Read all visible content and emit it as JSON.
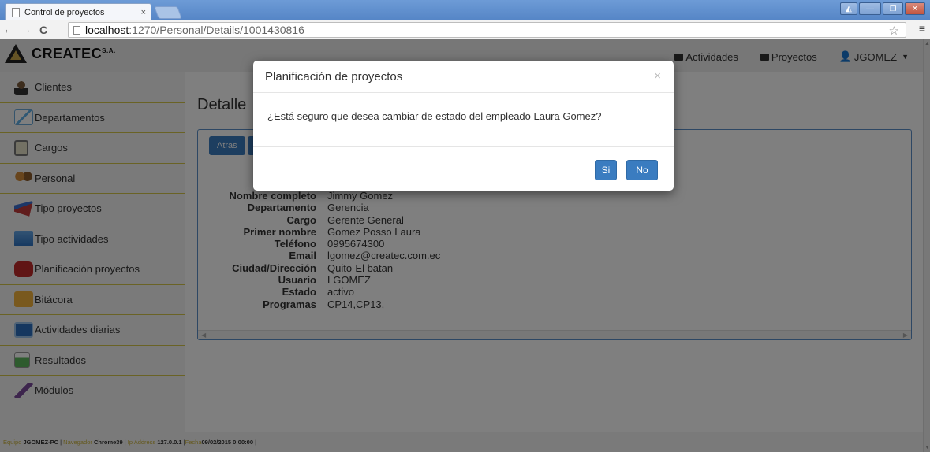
{
  "browser": {
    "tab_title": "Control de proyectos",
    "tab_close": "×",
    "url_host": "localhost",
    "url_path": ":1270/Personal/Details/1001430816",
    "win_controls": [
      "◭",
      "—",
      "❐",
      "✕"
    ]
  },
  "navbar": {
    "brand": "CREATEC",
    "brand_suffix": "S.A.",
    "items": [
      {
        "label": "Actividades",
        "icon": "list-icon"
      },
      {
        "label": "Proyectos",
        "icon": "folder-icon"
      },
      {
        "label": "JGOMEZ",
        "icon": "user-icon"
      }
    ]
  },
  "sidebar": {
    "items": [
      {
        "label": "Clientes",
        "icon": "clients-icon"
      },
      {
        "label": "Departamentos",
        "icon": "home-icon"
      },
      {
        "label": "Cargos",
        "icon": "checklist-icon"
      },
      {
        "label": "Personal",
        "icon": "people-icon"
      },
      {
        "label": "Tipo proyectos",
        "icon": "pen-icon"
      },
      {
        "label": "Tipo actividades",
        "icon": "cube-icon"
      },
      {
        "label": "Planificación proyectos",
        "icon": "toolbox-icon"
      },
      {
        "label": "Bitácora",
        "icon": "folder-icon"
      },
      {
        "label": "Actividades diarias",
        "icon": "team-icon"
      },
      {
        "label": "Resultados",
        "icon": "sheet-icon"
      },
      {
        "label": "Módulos",
        "icon": "edit-icon"
      }
    ]
  },
  "main": {
    "title": "Detalle",
    "back_button": "Atras",
    "details": [
      {
        "label": "Nombre completo",
        "value": "Jimmy Gomez"
      },
      {
        "label": "Departamento",
        "value": "Gerencia"
      },
      {
        "label": "Cargo",
        "value": "Gerente General"
      },
      {
        "label": "Primer nombre",
        "value": "Gomez Posso Laura"
      },
      {
        "label": "Teléfono",
        "value": "0995674300"
      },
      {
        "label": "Email",
        "value": "lgomez@createc.com.ec"
      },
      {
        "label": "Ciudad/Dirección",
        "value": "Quito-El batan"
      },
      {
        "label": "Usuario",
        "value": "LGOMEZ"
      },
      {
        "label": "Estado",
        "value": "activo"
      },
      {
        "label": "Programas",
        "value": "CP14,CP13,"
      }
    ]
  },
  "footer": {
    "equipo_label": "Equipo",
    "equipo": "JGOMEZ-PC",
    "navegador_label": "Navegador",
    "navegador": "Chrome39",
    "ip_label": "Ip Address",
    "ip": "127.0.0.1",
    "fecha_label": "Fecha",
    "fecha": "09/02/2015 0:00:00"
  },
  "modal": {
    "title": "Planificación de proyectos",
    "close": "×",
    "message": "¿Está seguro que desea cambiar de estado del empleado Laura Gomez?",
    "yes_label": "Si",
    "no_label": "No"
  },
  "colors": {
    "accent": "#3a7cc0",
    "divider": "#d4c64a",
    "footer_label": "#c9b13a"
  }
}
